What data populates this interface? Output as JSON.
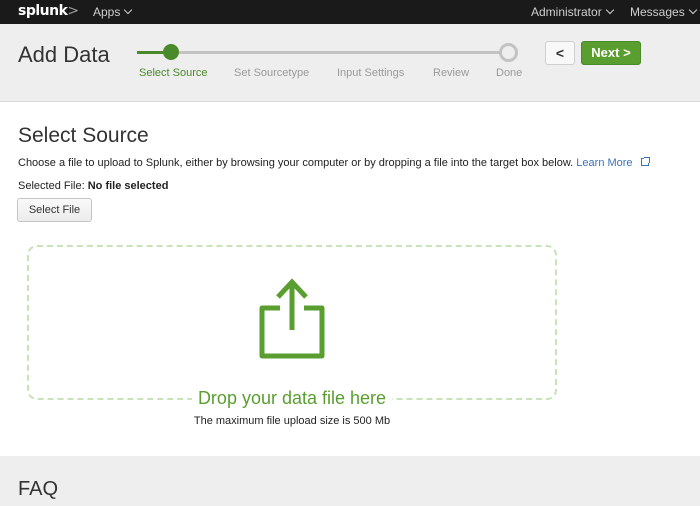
{
  "topbar": {
    "logo": "splunk",
    "logo_chevron": ">",
    "apps_label": "Apps",
    "user_label": "Administrator",
    "messages_label": "Messages"
  },
  "header": {
    "title": "Add Data",
    "steps": [
      {
        "label": "Select Source",
        "state": "active"
      },
      {
        "label": "Set Sourcetype",
        "state": "pending"
      },
      {
        "label": "Input Settings",
        "state": "pending"
      },
      {
        "label": "Review",
        "state": "pending"
      },
      {
        "label": "Done",
        "state": "pending"
      }
    ],
    "back_label": "<",
    "next_label": "Next >"
  },
  "main": {
    "section_title": "Select Source",
    "description": "Choose a file to upload to Splunk, either by browsing your computer or by dropping a file into the target box below.",
    "learn_more": "Learn More",
    "selected_file_label": "Selected File:",
    "selected_file_value": "No file selected",
    "select_file_button": "Select File",
    "drop_text": "Drop your data file here",
    "max_size_text": "The maximum file upload size is 500 Mb"
  },
  "faq": {
    "title": "FAQ"
  },
  "colors": {
    "accent_green": "#5a9e30",
    "step_green": "#4a8a2a",
    "link_blue": "#3a73b8",
    "topbar_bg": "#1a1a1a"
  }
}
